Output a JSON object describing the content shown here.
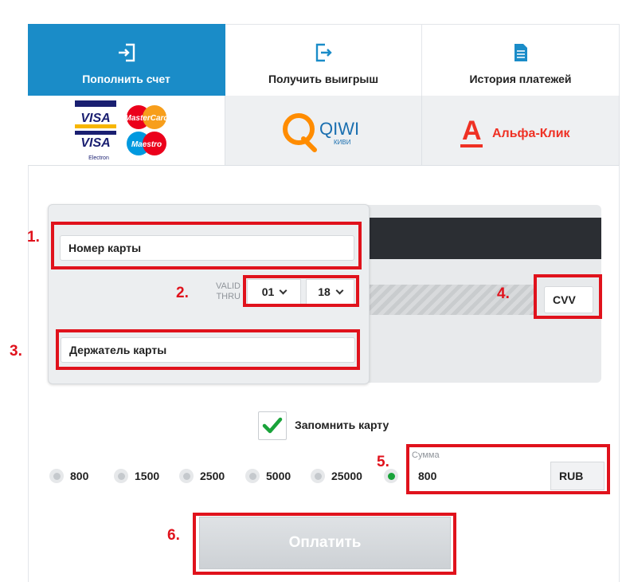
{
  "tabs": [
    {
      "label": "Пополнить счет",
      "icon": "login-icon",
      "active": true
    },
    {
      "label": "Получить выигрыш",
      "icon": "logout-icon",
      "active": false
    },
    {
      "label": "История платежей",
      "icon": "document-icon",
      "active": false
    }
  ],
  "payment_methods": {
    "cards": {
      "visa": "VISA",
      "visa_electron": "VISA",
      "electron_sub": "Electron",
      "mastercard": "MasterCard",
      "maestro": "Maestro"
    },
    "qiwi": {
      "name": "QIWI",
      "sub": "КИВИ"
    },
    "alfa": {
      "letter": "А",
      "name": "Альфа-Клик"
    }
  },
  "card_form": {
    "card_number_placeholder": "Номер карты",
    "valid_thru_line1": "VALID",
    "valid_thru_line2": "THRU",
    "month": "01",
    "year": "18",
    "holder_placeholder": "Держатель карты",
    "cvv_placeholder": "CVV"
  },
  "remember": {
    "label": "Запомнить карту",
    "checked": true
  },
  "amounts": [
    "800",
    "1500",
    "2500",
    "5000",
    "25000"
  ],
  "sum": {
    "label": "Сумма",
    "value": "800",
    "currency": "RUB"
  },
  "pay_button": "Оплатить",
  "annotations": [
    "1.",
    "2.",
    "3.",
    "4.",
    "5.",
    "6."
  ],
  "colors": {
    "accent": "#1a8cc8",
    "annotation": "#e0121c",
    "check": "#19a33a"
  }
}
